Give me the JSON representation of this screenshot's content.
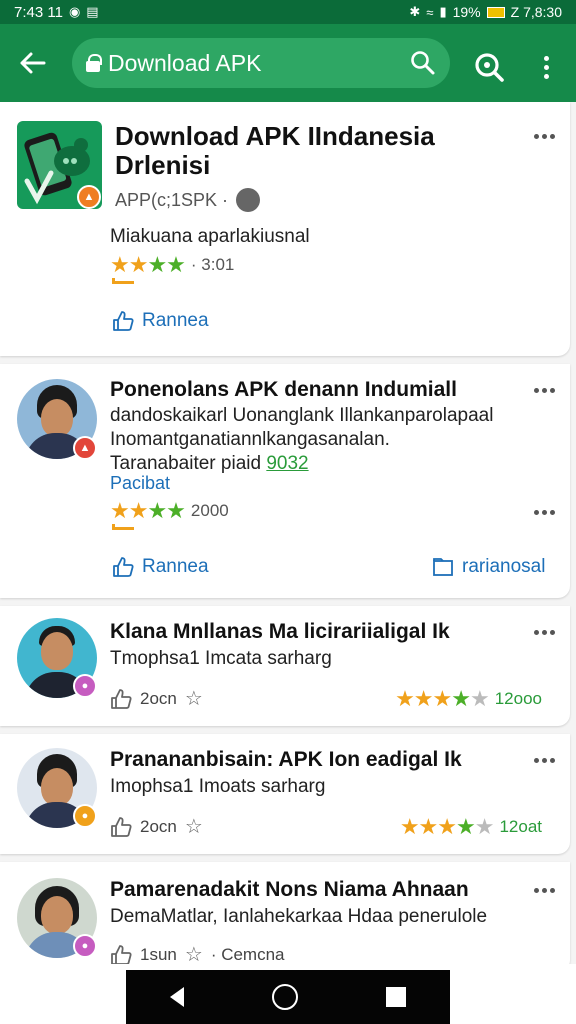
{
  "statusbar": {
    "time": "7:43 11",
    "battery_percent": "19%",
    "clock_right": "Z 7,8:30"
  },
  "toolbar": {
    "back_icon": "arrow-left-icon",
    "search_text": "Download APK"
  },
  "app_card": {
    "title": "Download APK IIndanesia Drlenisi",
    "meta": "APP(c;1SPK ·",
    "description": "Miakuana aparlakiusnal",
    "rating_label": "· 3:01",
    "stars": 4,
    "action_label": "Rannea"
  },
  "reviews": [
    {
      "title": "Ponenolans APK denann Indumiall",
      "line1": "dandoskaikarl Uonanglank Illankanparolapaal",
      "line2": "Inomantganatiannlkangasanalan.",
      "line3_prefix": "Taranabaiter piaid",
      "line3_link": "9032",
      "line4": "Pacibat",
      "rating_label": "2000",
      "stars": 4,
      "action_left": "Rannea",
      "action_right": "rarianosal"
    },
    {
      "title": "Klana Mnllanas Ma licirariialigal Ik",
      "line1": "Tmophsa1 Imcata sarharg",
      "likes": "2ocn",
      "rating_label": "12ooo",
      "stars": 4
    },
    {
      "title": "Pranananbisain: APK Ion eadigal Ik",
      "line1": "Imophsa1 Imoats sarharg",
      "likes": "2ocn",
      "rating_label": "12oat",
      "stars": 4
    },
    {
      "title": "Pamarenadakit Nons Niama Ahnaan",
      "line1": "DemaMatlar, Ianlahekarkaa Hdaa penerulole",
      "likes": "1sun",
      "extra": "· Cemcna"
    }
  ],
  "colors": {
    "toolbar": "#158a4a",
    "statusbar": "#0b6b39",
    "accent_blue": "#1d6fb8",
    "star_gold": "#f0a11b",
    "star_green": "#4caf28"
  }
}
